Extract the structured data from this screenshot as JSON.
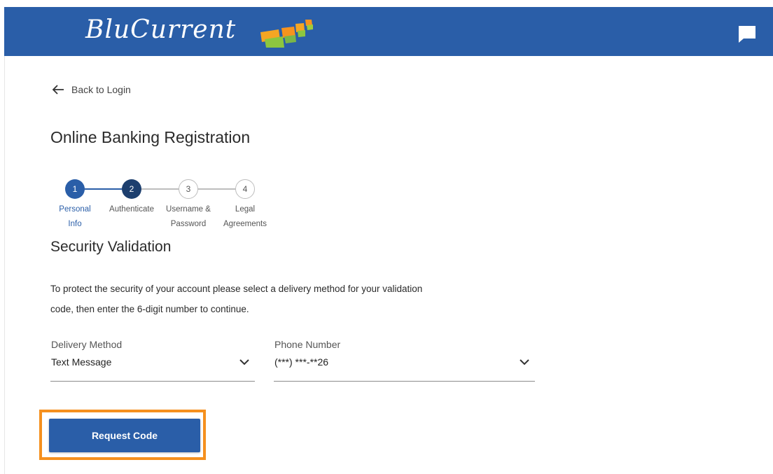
{
  "header": {
    "brand": "BluCurrent",
    "brand_color": "#2a5ea8",
    "chat_icon": "chat-bubble-icon"
  },
  "nav": {
    "back_label": "Back to Login",
    "back_icon": "arrow-left-icon"
  },
  "page": {
    "title": "Online Banking Registration"
  },
  "stepper": {
    "current_step": 2,
    "steps": [
      {
        "number": "1",
        "label_line1": "Personal",
        "label_line2": "Info",
        "state": "done"
      },
      {
        "number": "2",
        "label_line1": "Authenticate",
        "label_line2": "",
        "state": "active"
      },
      {
        "number": "3",
        "label_line1": "Username &",
        "label_line2": "Password",
        "state": "todo"
      },
      {
        "number": "4",
        "label_line1": "Legal",
        "label_line2": "Agreements",
        "state": "todo"
      }
    ]
  },
  "security": {
    "title": "Security Validation",
    "description_line1": "To protect the security of your account please select a delivery method for your validation",
    "description_line2": "code, then enter the 6-digit number to continue.",
    "delivery_method": {
      "label": "Delivery Method",
      "value": "Text Message"
    },
    "phone_number": {
      "label": "Phone Number",
      "value": "(***) ***-**26"
    },
    "request_button_label": "Request Code",
    "highlight_color": "#f5901e"
  }
}
